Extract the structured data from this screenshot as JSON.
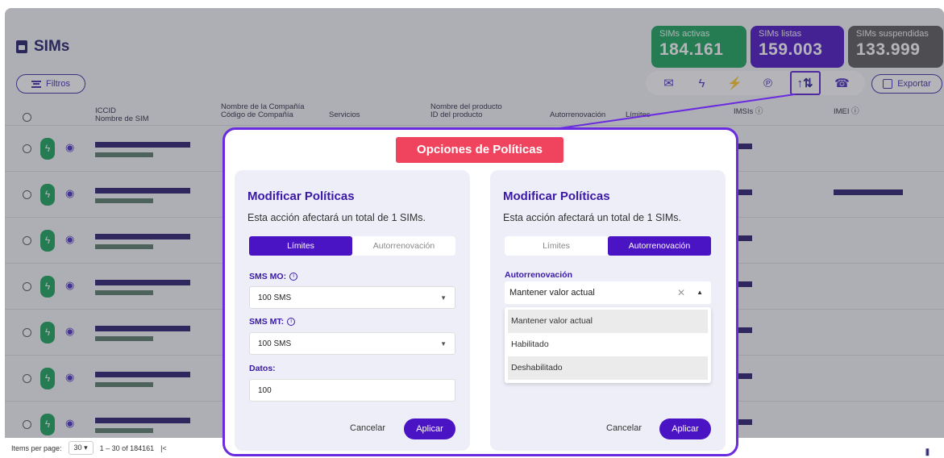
{
  "header": {
    "title": "SIMs"
  },
  "stats": [
    {
      "label": "SIMs activas",
      "value": "184.161",
      "color": "#17a35a"
    },
    {
      "label": "SIMs listas",
      "value": "159.003",
      "color": "#4a13c4"
    },
    {
      "label": "SIMs suspendidas",
      "value": "133.999",
      "color": "#5a5a5a"
    }
  ],
  "toolbar": {
    "filters_label": "Filtros",
    "export_label": "Exportar",
    "icons": [
      "mail-icon",
      "bolt-icon",
      "bolt-off-icon",
      "ear-icon",
      "policies-icon",
      "sim-settings-icon"
    ]
  },
  "table": {
    "columns": {
      "iccid": "ICCID",
      "sim_name": "Nombre de SIM",
      "company_name": "Nombre de la Compañía",
      "company_code": "Código de Compañía",
      "services": "Servicios",
      "product_name": "Nombre del producto",
      "product_id": "ID del producto",
      "autorenew": "Autorrenovación",
      "limits": "Límites",
      "imsis": "IMSIs",
      "imei": "IMEI"
    }
  },
  "footer": {
    "items_per_page_label": "Items per page:",
    "items_per_page_value": "30",
    "range": "1 – 30 of 184161"
  },
  "modal": {
    "title": "Opciones de Políticas",
    "left": {
      "title": "Modificar Políticas",
      "subtitle": "Esta acción afectará un total de 1 SIMs.",
      "tab_limits": "Límites",
      "tab_autorenew": "Autorrenovación",
      "sms_mo_label": "SMS MO:",
      "sms_mo_value": "100 SMS",
      "sms_mt_label": "SMS MT:",
      "sms_mt_value": "100 SMS",
      "data_label": "Datos:",
      "data_value": "100",
      "cancel": "Cancelar",
      "apply": "Aplicar"
    },
    "right": {
      "title": "Modificar Políticas",
      "subtitle": "Esta acción afectará un total de 1 SIMs.",
      "tab_limits": "Límites",
      "tab_autorenew": "Autorrenovación",
      "autorenew_label": "Autorrenovación",
      "autorenew_value": "Mantener valor actual",
      "options": [
        "Mantener valor actual",
        "Habilitado",
        "Deshabilitado"
      ],
      "cancel": "Cancelar",
      "apply": "Aplicar"
    }
  }
}
